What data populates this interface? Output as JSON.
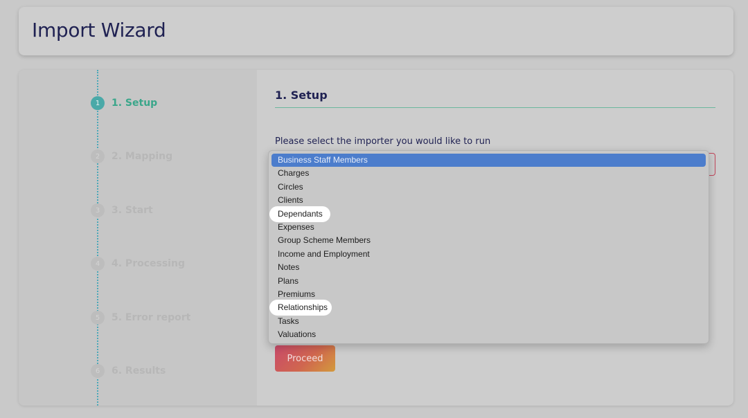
{
  "header": {
    "title": "Import Wizard"
  },
  "steps": [
    {
      "num": "1",
      "label": "1. Setup",
      "active": true
    },
    {
      "num": "2",
      "label": "2. Mapping",
      "active": false
    },
    {
      "num": "3",
      "label": "3. Start",
      "active": false
    },
    {
      "num": "4",
      "label": "4. Processing",
      "active": false
    },
    {
      "num": "5",
      "label": "5. Error report",
      "active": false
    },
    {
      "num": "6",
      "label": "6. Results",
      "active": false
    }
  ],
  "content": {
    "section_title": "1. Setup",
    "prompt": "Please select the importer you would like to run",
    "proceed_label": "Proceed"
  },
  "dropdown": {
    "selected": "Business Staff Members",
    "options": [
      "Business Staff Members",
      "Charges",
      "Circles",
      "Clients",
      "Dependants",
      "Expenses",
      "Group Scheme Members",
      "Income and Employment",
      "Notes",
      "Plans",
      "Premiums",
      "Relationships",
      "Tasks",
      "Valuations"
    ]
  },
  "colors": {
    "accent": "#4aa9a8",
    "selected_option": "#4c7dcc",
    "error_border": "#c2455a"
  }
}
